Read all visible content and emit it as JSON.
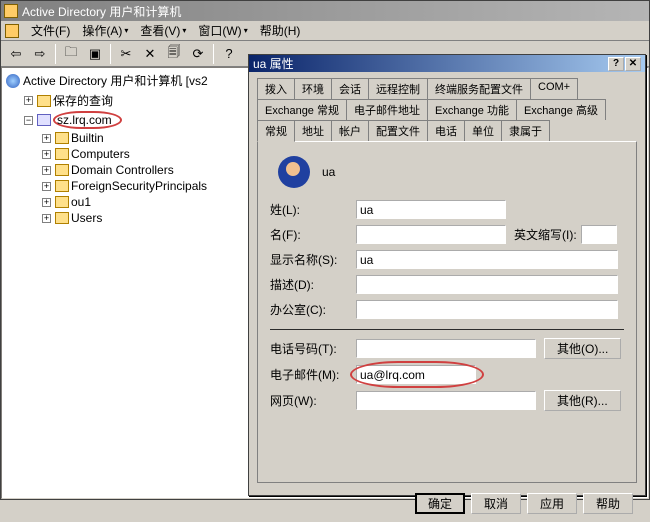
{
  "window": {
    "title": "Active Directory 用户和计算机"
  },
  "menu": {
    "file": "文件(F)",
    "action": "操作(A)",
    "view": "查看(V)",
    "window": "窗口(W)",
    "help": "帮助(H)"
  },
  "tree": {
    "root": "Active Directory 用户和计算机 [vs2",
    "saved_queries": "保存的查询",
    "domain": "sz.lrq.com",
    "children": [
      "Builtin",
      "Computers",
      "Domain Controllers",
      "ForeignSecurityPrincipals",
      "ou1",
      "Users"
    ]
  },
  "dialog": {
    "title": "ua 属性",
    "tabs_row1": [
      "拨入",
      "环境",
      "会话",
      "远程控制",
      "终端服务配置文件",
      "COM+"
    ],
    "tabs_row2": [
      "Exchange 常规",
      "电子邮件地址",
      "Exchange 功能",
      "Exchange 高级"
    ],
    "tabs_row3": [
      "常规",
      "地址",
      "帐户",
      "配置文件",
      "电话",
      "单位",
      "隶属于"
    ],
    "active_tab": "常规",
    "header_name": "ua",
    "fields": {
      "last_name_label": "姓(L):",
      "last_name": "ua",
      "first_name_label": "名(F):",
      "first_name": "",
      "initials_label": "英文缩写(I):",
      "initials": "",
      "display_label": "显示名称(S):",
      "display": "ua",
      "desc_label": "描述(D):",
      "desc": "",
      "office_label": "办公室(C):",
      "office": "",
      "phone_label": "电话号码(T):",
      "phone": "",
      "other_o": "其他(O)...",
      "email_label": "电子邮件(M):",
      "email": "ua@lrq.com",
      "web_label": "网页(W):",
      "web": "",
      "other_r": "其他(R)..."
    },
    "buttons": {
      "ok": "确定",
      "cancel": "取消",
      "apply": "应用",
      "help": "帮助"
    }
  }
}
